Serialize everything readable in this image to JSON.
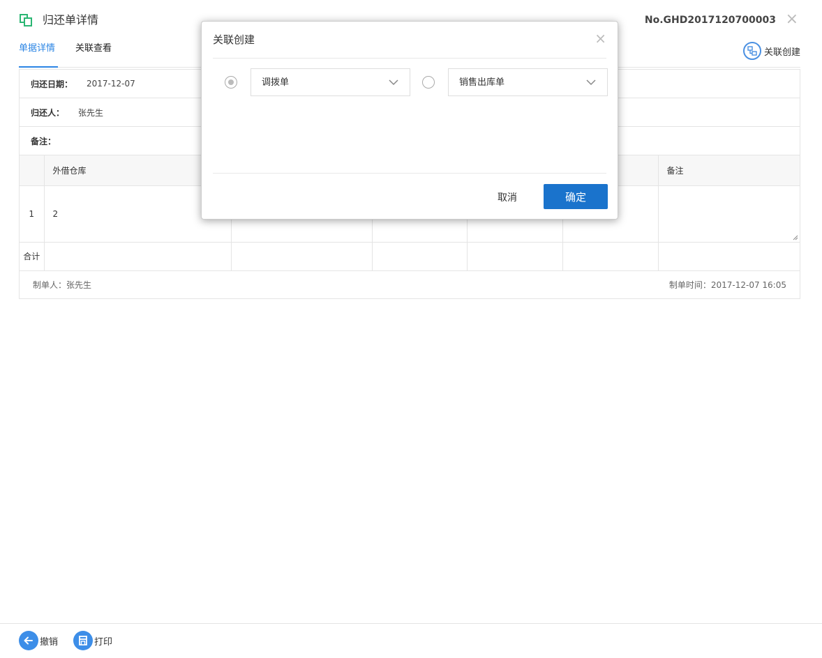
{
  "header": {
    "title": "归还单详情",
    "doc_no": "No.GHD2017120700003",
    "close_symbol": "×"
  },
  "tabs": [
    {
      "label": "单据详情",
      "active": true
    },
    {
      "label": "关联查看",
      "active": false
    }
  ],
  "related_create": {
    "label": "关联创建"
  },
  "detail": {
    "return_date": {
      "label": "归还日期：",
      "value": "2017-12-07"
    },
    "returner": {
      "label": "归还人：",
      "value": "张先生"
    },
    "remark": {
      "label": "备注："
    },
    "table": {
      "headers": [
        "",
        "外借仓库",
        "",
        "",
        "",
        "",
        "备注"
      ],
      "rows": [
        {
          "index": "1",
          "cells": [
            "2",
            "",
            "",
            "",
            "",
            ""
          ]
        }
      ],
      "total_label": "合计"
    },
    "creator": "制单人：张先生",
    "created_time": "制单时间：2017-12-07 16:05"
  },
  "bottom_bar": {
    "revoke_label": "撤销",
    "print_label": "打印"
  },
  "modal": {
    "title": "关联创建",
    "close_symbol": "×",
    "option_1": {
      "selected": true,
      "value": "调拨单"
    },
    "option_2": {
      "selected": false,
      "value": "销售出库单"
    },
    "cancel_label": "取消",
    "ok_label": "确定"
  },
  "colors": {
    "accent": "#2b85e4",
    "primary_button": "#1a73cc",
    "header_icon": "#2bb673"
  }
}
